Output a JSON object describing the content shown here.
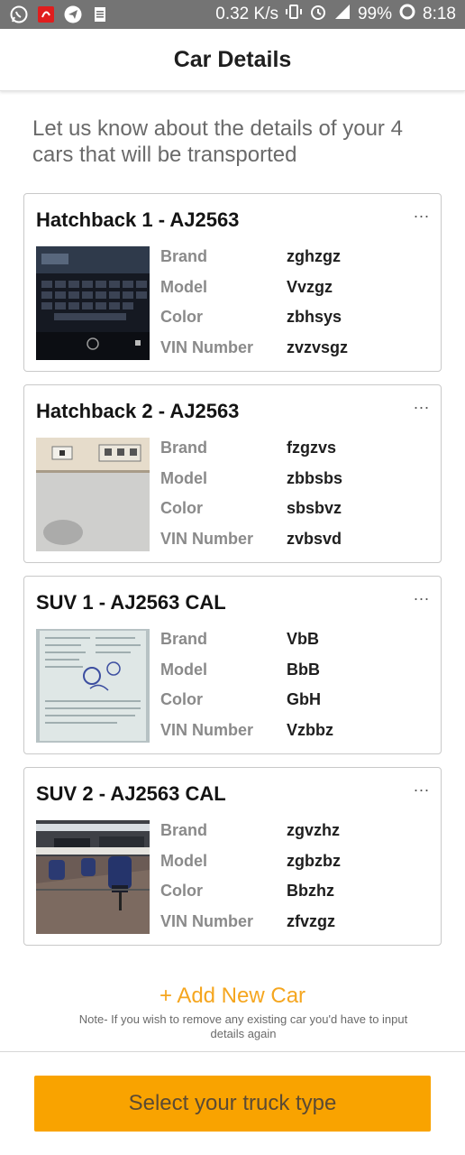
{
  "status_bar": {
    "left_icons": [
      "whatsapp-icon",
      "airtel-icon",
      "telegram-icon",
      "clipboard-icon"
    ],
    "net_speed": "0.32 K/s",
    "battery": "99%",
    "time": "8:18"
  },
  "header": {
    "title": "Car Details"
  },
  "intro": "Let us know about the details of your 4 cars that will be transported",
  "field_labels": {
    "brand": "Brand",
    "model": "Model",
    "color": "Color",
    "vin": "VIN Number"
  },
  "cars": [
    {
      "title": "Hatchback 1 - AJ2563",
      "brand": "zghzgz",
      "model": "Vvzgz",
      "color": "zbhsys",
      "vin": "zvzvsgz",
      "thumb": "keyboard-photo"
    },
    {
      "title": "Hatchback 2 - AJ2563",
      "brand": "fzgzvs",
      "model": "zbbsbs",
      "color": "sbsbvz",
      "vin": "zvbsvd",
      "thumb": "wall-switch-photo"
    },
    {
      "title": "SUV 1 - AJ2563 CAL",
      "brand": "VbB",
      "model": "BbB",
      "color": "GbH",
      "vin": "Vzbbz",
      "thumb": "document-photo"
    },
    {
      "title": "SUV 2 - AJ2563 CAL",
      "brand": "zgvzhz",
      "model": "zgbzbz",
      "color": "Bbzhz",
      "vin": "zfvzgz",
      "thumb": "office-chairs-photo"
    }
  ],
  "more_label": "...",
  "add_car": "+ Add New Car",
  "note": "Note- If you wish to remove any existing car you'd have to input details again",
  "cta": "Select your truck type",
  "colors": {
    "accent": "#f9a300",
    "status_bar": "#747474"
  }
}
